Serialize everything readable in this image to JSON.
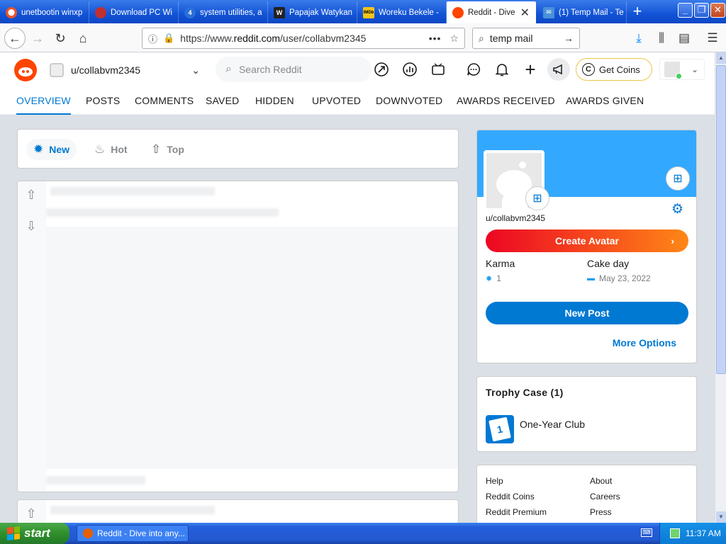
{
  "browser": {
    "tabs": [
      {
        "title": "unetbootin winxp",
        "favicon_color": "#e8532b",
        "active": false
      },
      {
        "title": "Download PC Wi",
        "favicon_color": "#c03030",
        "active": false
      },
      {
        "title": "system utilities, a",
        "favicon_color": "#2a6fd8",
        "active": false
      },
      {
        "title": "Papajak Watykan",
        "favicon_color": "#222222",
        "active": false
      },
      {
        "title": "Woreku Bekele -",
        "favicon_color": "#f5c518",
        "active": false
      },
      {
        "title": "Reddit - Dive",
        "favicon_color": "#ff4500",
        "active": true
      },
      {
        "title": "(1) Temp Mail - Te",
        "favicon_color": "#4a90d9",
        "active": false
      }
    ],
    "address": {
      "prefix": "https://www.",
      "domain": "reddit.com",
      "path": "/user/collabvm2345"
    },
    "search_query": "temp mail"
  },
  "reddit": {
    "header": {
      "username": "u/collabvm2345",
      "search_placeholder": "Search Reddit",
      "coins_label": "Get Coins"
    },
    "tabs": [
      "OVERVIEW",
      "POSTS",
      "COMMENTS",
      "SAVED",
      "HIDDEN",
      "UPVOTED",
      "DOWNVOTED",
      "AWARDS RECEIVED",
      "AWARDS GIVEN"
    ],
    "active_tab": "OVERVIEW",
    "sort": [
      {
        "label": "New",
        "icon": "sparkle-icon",
        "active": true
      },
      {
        "label": "Hot",
        "icon": "flame-icon",
        "active": false
      },
      {
        "label": "Top",
        "icon": "podium-icon",
        "active": false
      }
    ],
    "profile_card": {
      "username": "u/collabvm2345",
      "create_avatar_label": "Create Avatar",
      "karma_label": "Karma",
      "karma_value": "1",
      "cake_label": "Cake day",
      "cake_value": "May 23, 2022",
      "new_post_label": "New Post",
      "more_options_label": "More Options"
    },
    "trophy_case": {
      "title": "Trophy Case (1)",
      "trophies": [
        "One-Year Club"
      ]
    },
    "footer_links": {
      "left": [
        "Help",
        "Reddit Coins",
        "Reddit Premium"
      ],
      "right": [
        "About",
        "Careers",
        "Press"
      ]
    }
  },
  "taskbar": {
    "start_label": "start",
    "window_label": "Reddit - Dive into any...",
    "clock": "11:37 AM"
  }
}
